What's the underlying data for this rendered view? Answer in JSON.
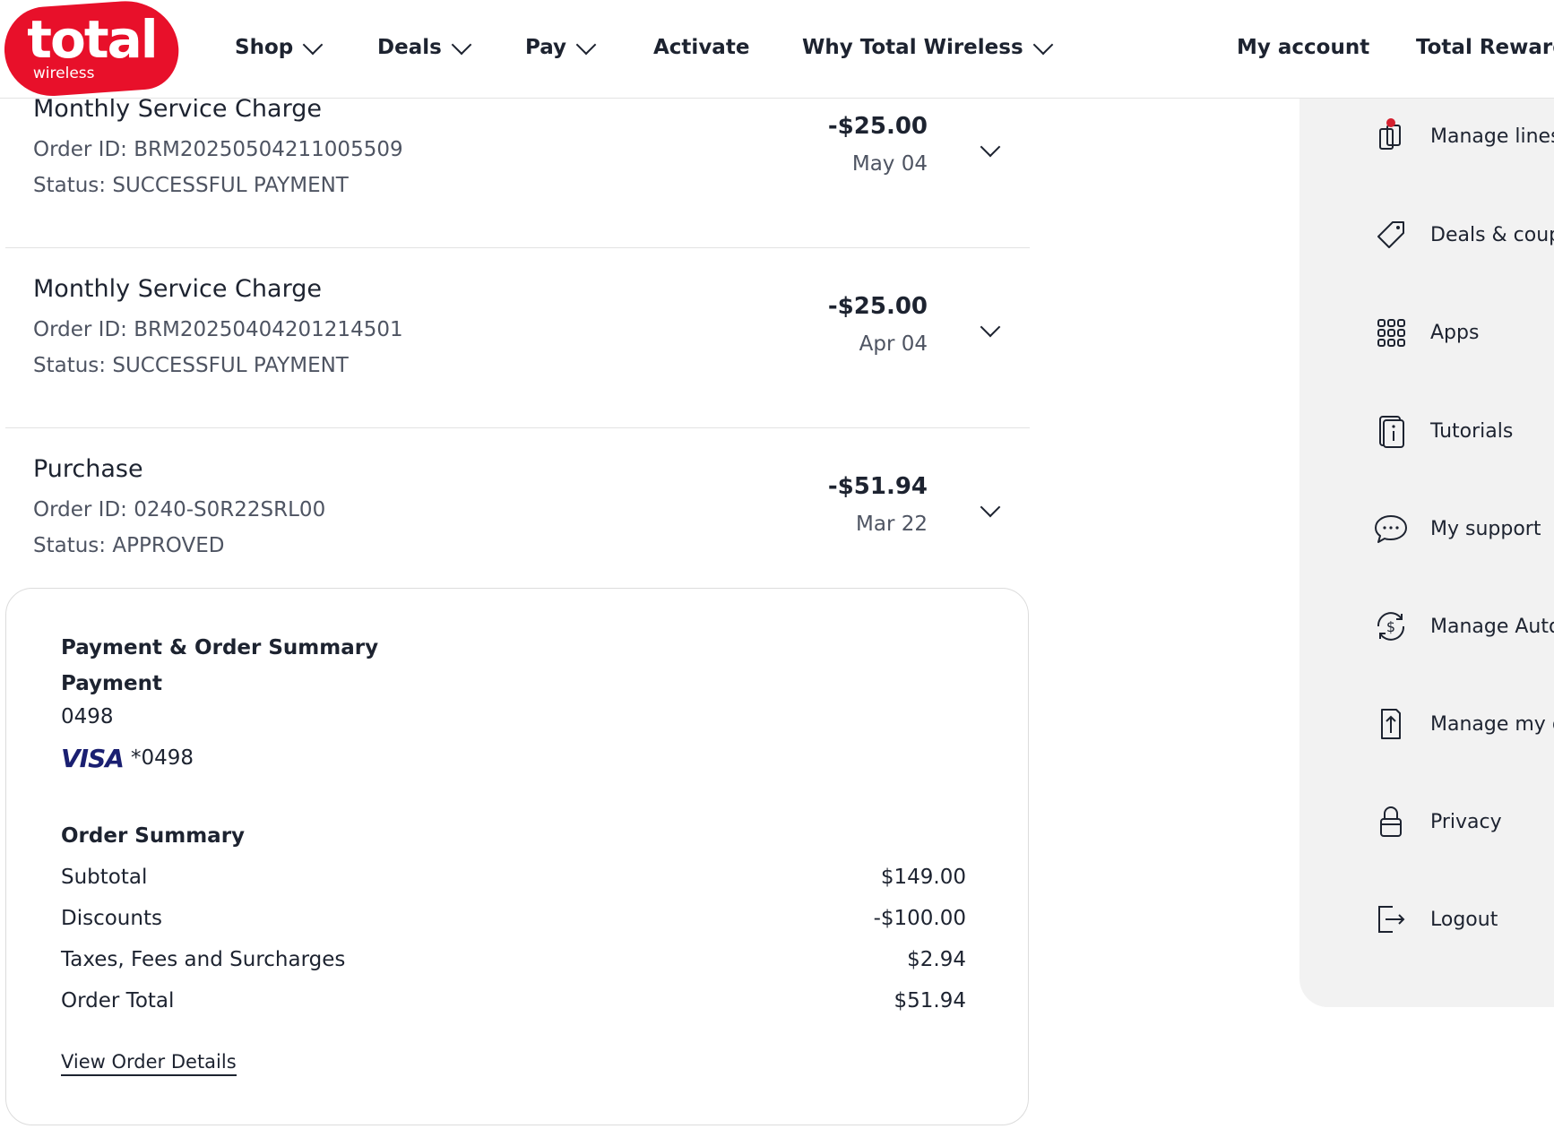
{
  "brand": {
    "name": "total",
    "sub": "wireless",
    "color": "#e8102a"
  },
  "nav": {
    "shop": "Shop",
    "deals": "Deals",
    "pay": "Pay",
    "activate": "Activate",
    "why": "Why Total Wireless",
    "my_account": "My account",
    "rewards": "Total Rewards"
  },
  "transactions": [
    {
      "title": "Monthly Service Charge",
      "order_id": "Order ID: BRM20250504211005509",
      "status": "Status: SUCCESSFUL PAYMENT",
      "amount": "-$25.00",
      "date": "May 04"
    },
    {
      "title": "Monthly Service Charge",
      "order_id": "Order ID: BRM20250404201214501",
      "status": "Status: SUCCESSFUL PAYMENT",
      "amount": "-$25.00",
      "date": "Apr 04"
    },
    {
      "title": "Purchase",
      "order_id": "Order ID: 0240-S0R22SRL00",
      "status": "Status: APPROVED",
      "amount": "-$51.94",
      "date": "Mar 22"
    }
  ],
  "detail": {
    "heading": "Payment & Order Summary",
    "payment_label": "Payment",
    "payment_last4": "0498",
    "card_brand": "VISA",
    "card_masked": "*0498",
    "summary_heading": "Order Summary",
    "rows": [
      {
        "label": "Subtotal",
        "value": "$149.00"
      },
      {
        "label": "Discounts",
        "value": "-$100.00"
      },
      {
        "label": "Taxes, Fees and Surcharges",
        "value": "$2.94"
      },
      {
        "label": "Order Total",
        "value": "$51.94"
      }
    ],
    "link": "View Order Details"
  },
  "side_menu": [
    {
      "icon": "phone-lines-icon",
      "label": "Manage lines"
    },
    {
      "icon": "tag-icon",
      "label": "Deals & coupons"
    },
    {
      "icon": "apps-grid-icon",
      "label": "Apps"
    },
    {
      "icon": "tutorials-icon",
      "label": "Tutorials"
    },
    {
      "icon": "chat-bubble-icon",
      "label": "My support"
    },
    {
      "icon": "autopay-icon",
      "label": "Manage AutoPay"
    },
    {
      "icon": "upload-device-icon",
      "label": "Manage my devices"
    },
    {
      "icon": "lock-icon",
      "label": "Privacy"
    },
    {
      "icon": "logout-icon",
      "label": "Logout"
    }
  ]
}
